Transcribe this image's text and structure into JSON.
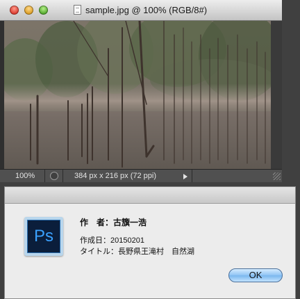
{
  "document_window": {
    "title": "sample.jpg @ 100% (RGB/8#)",
    "status": {
      "zoom": "100%",
      "info": "384 px x 216 px (72 ppi)"
    }
  },
  "dialog": {
    "author": "作　者：古籏一浩",
    "created": "作成日：20150201",
    "title": "タイトル：長野県王滝村　自然湖",
    "icon_label": "Ps",
    "ok_label": "OK"
  }
}
